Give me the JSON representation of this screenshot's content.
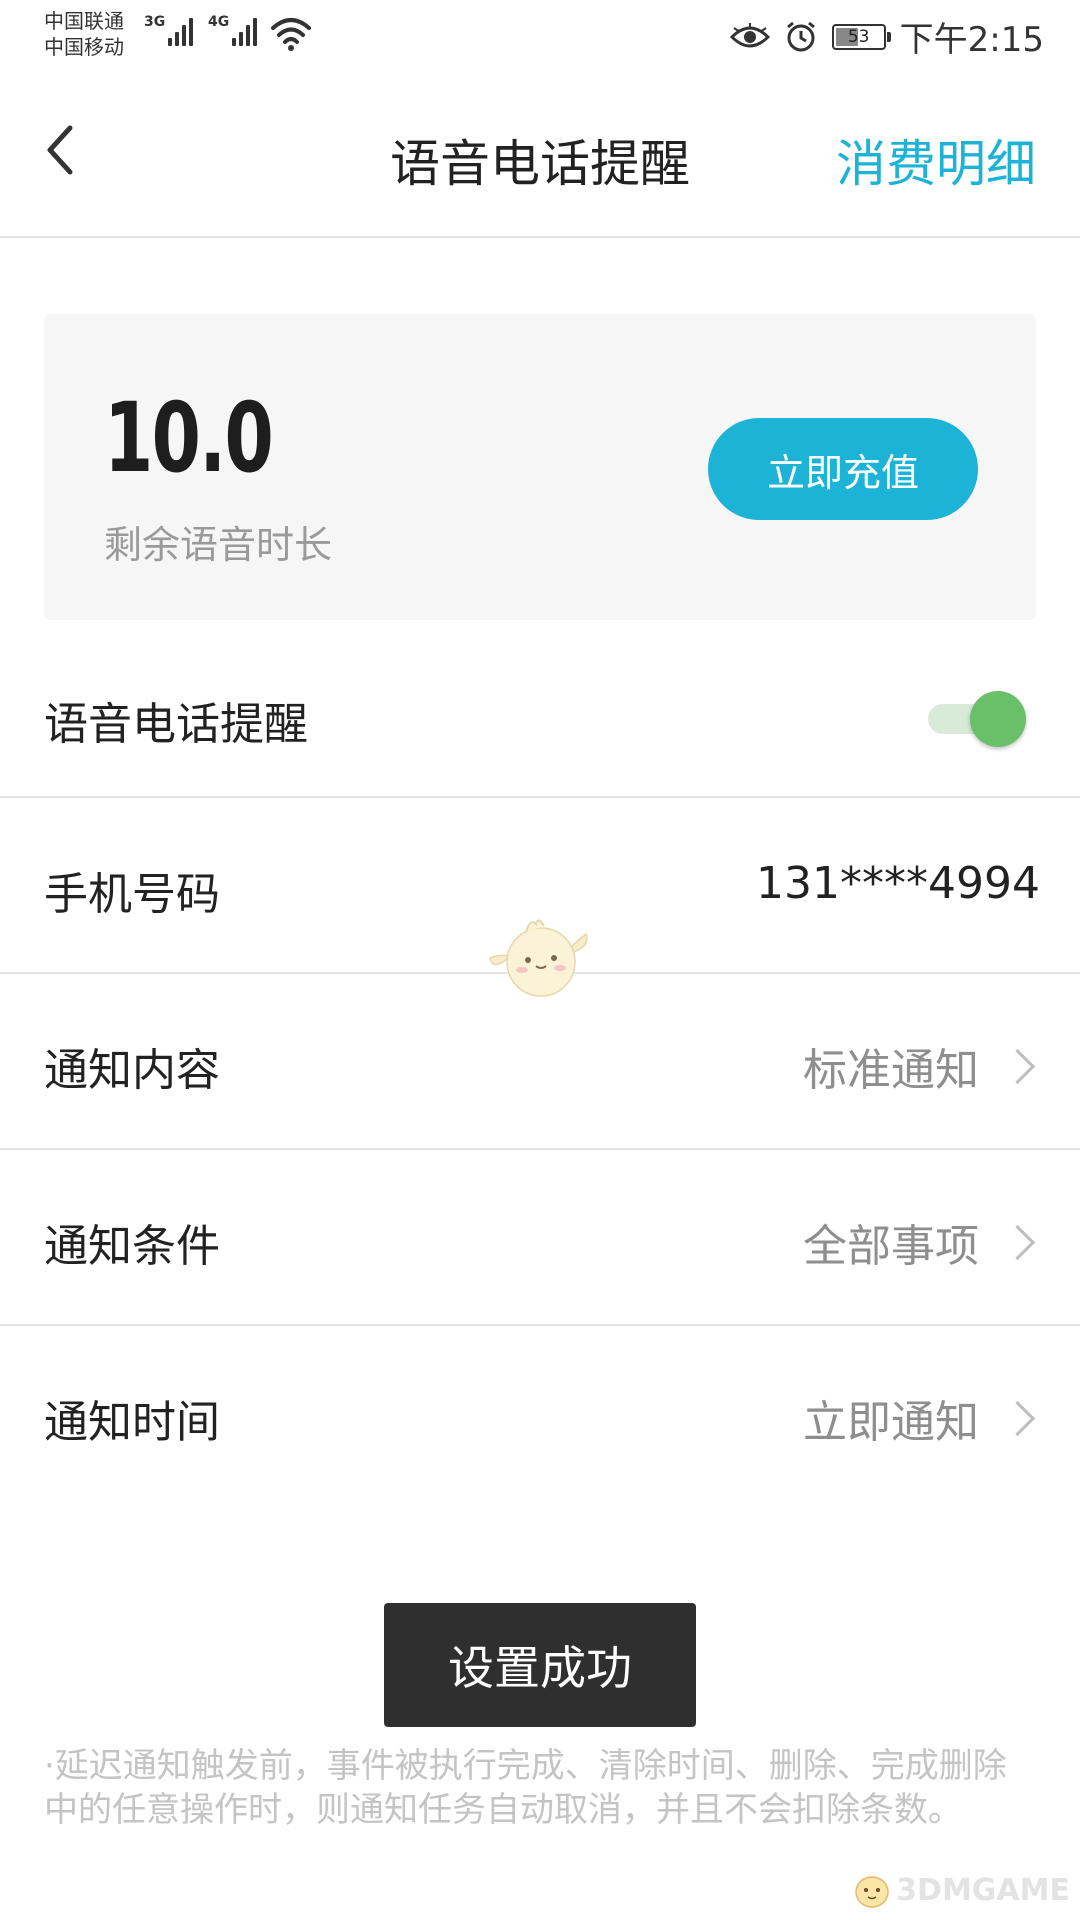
{
  "status_bar": {
    "carrier_1": "中国联通",
    "carrier_2": "中国移动",
    "net_1": "3G",
    "net_2": "4G",
    "battery": "53",
    "battery_level": 0.53,
    "time": "下午2:15"
  },
  "header": {
    "title": "语音电话提醒",
    "detail_link": "消费明细"
  },
  "balance_card": {
    "value": "10.0",
    "label": "剩余语音时长",
    "recharge_button": "立即充值"
  },
  "settings": {
    "voice_reminder": {
      "label": "语音电话提醒",
      "enabled": true
    },
    "phone": {
      "label": "手机号码",
      "value": "131****4994"
    },
    "content": {
      "label": "通知内容",
      "value": "标准通知"
    },
    "condition": {
      "label": "通知条件",
      "value": "全部事项"
    },
    "time": {
      "label": "通知时间",
      "value": "立即通知"
    }
  },
  "toast": "设置成功",
  "note": "·延迟通知触发前，事件被执行完成、清除时间、删除、完成删除中的任意操作时，则通知任务自动取消，并且不会扣除条数。",
  "watermark": "3DMGAME",
  "colors": {
    "accent": "#1cb3d6",
    "toggle_on": "#6abf69",
    "toast_bg": "#2f2f2f"
  }
}
